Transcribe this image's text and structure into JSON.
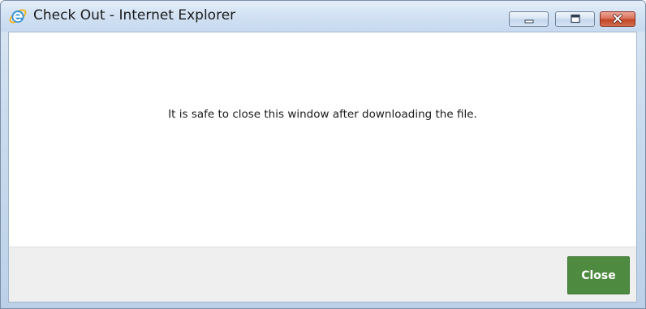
{
  "window": {
    "title": "Check Out - Internet Explorer",
    "app_icon": "internet-explorer-icon",
    "controls": {
      "minimize_icon": "minimize-icon",
      "maximize_icon": "maximize-icon",
      "close_icon": "close-icon"
    }
  },
  "content": {
    "message": "It is safe to close this window after downloading the file."
  },
  "footer": {
    "close_label": "Close"
  },
  "colors": {
    "close_button": "#4e8a3f",
    "window_close": "#c24527",
    "titlebar": "#d3e2f3"
  }
}
